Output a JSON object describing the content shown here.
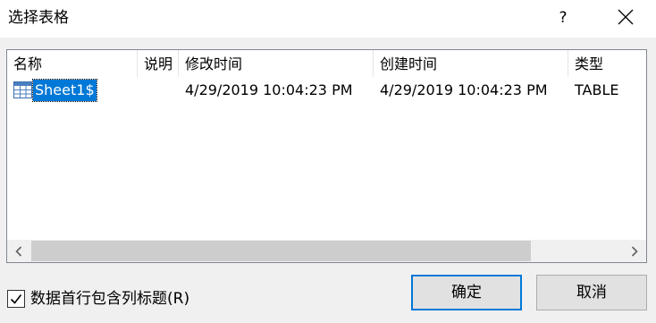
{
  "window": {
    "title": "选择表格",
    "help_label": "?"
  },
  "list": {
    "columns": [
      "名称",
      "说明",
      "修改时间",
      "创建时间",
      "类型"
    ],
    "rows": [
      {
        "icon": "table-icon",
        "name": "Sheet1$",
        "description": "",
        "modified": "4/29/2019 10:04:23 PM",
        "created": "4/29/2019 10:04:23 PM",
        "type": "TABLE",
        "selected": true
      }
    ]
  },
  "scrollbar": {
    "left_icon": "chevron-left-icon",
    "right_icon": "chevron-right-icon"
  },
  "options": {
    "first_row_headers_label": "数据首行包含列标题(R)",
    "first_row_headers_checked": true
  },
  "buttons": {
    "ok_label": "确定",
    "cancel_label": "取消"
  },
  "colors": {
    "selection": "#0078d7",
    "focus_border": "#0078d7",
    "dialog_background": "#f0f0f0"
  }
}
